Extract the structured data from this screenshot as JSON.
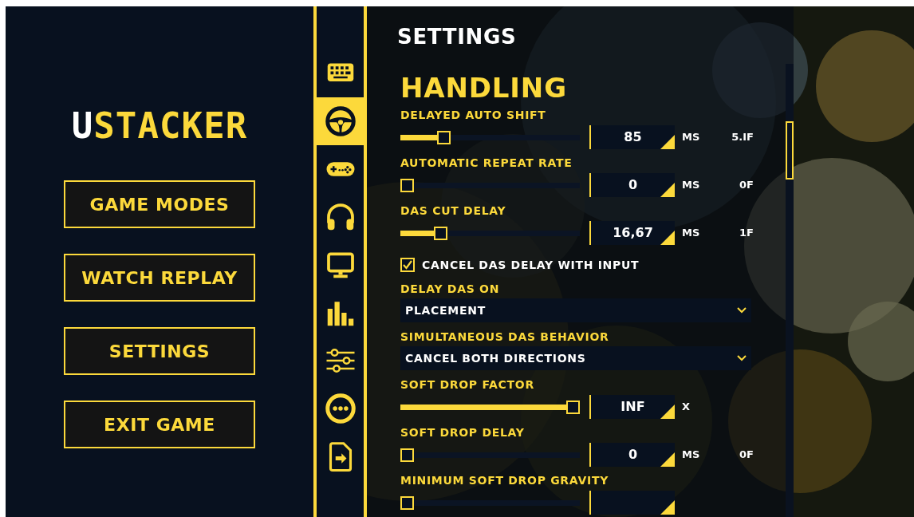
{
  "logo": {
    "lead": "U",
    "rest": "STACKER"
  },
  "menu": [
    "GAME MODES",
    "WATCH REPLAY",
    "SETTINGS",
    "EXIT GAME"
  ],
  "tabs": [
    {
      "selected": false
    },
    {
      "selected": true
    },
    {
      "selected": false
    },
    {
      "selected": false
    },
    {
      "selected": false
    },
    {
      "selected": false
    },
    {
      "selected": false
    },
    {
      "selected": false
    },
    {
      "selected": false
    }
  ],
  "title": "SETTINGS",
  "section": "HANDLING",
  "settings": [
    {
      "kind": "slider",
      "label": "DELAYED AUTO SHIFT",
      "level": 0.22,
      "value": "85",
      "unit": "MS",
      "frames": "5.IF"
    },
    {
      "kind": "slider",
      "label": "AUTOMATIC REPEAT RATE",
      "level": 0,
      "value": "0",
      "unit": "MS",
      "frames": "0F"
    },
    {
      "kind": "slider",
      "label": "DAS CUT DELAY",
      "level": 0.2,
      "value": "16,67",
      "unit": "MS",
      "frames": "1F"
    },
    {
      "kind": "checkbox",
      "label": "CANCEL DAS DELAY WITH INPUT",
      "checked": true
    },
    {
      "kind": "select",
      "label": "DELAY DAS ON",
      "value": "PLACEMENT"
    },
    {
      "kind": "select",
      "label": "SIMULTANEOUS DAS BEHAVIOR",
      "value": "CANCEL BOTH DIRECTIONS"
    },
    {
      "kind": "slider",
      "label": "SOFT DROP FACTOR",
      "level": 1,
      "value": "INF",
      "unit": "X"
    },
    {
      "kind": "slider",
      "label": "SOFT DROP DELAY",
      "level": 0,
      "value": "0",
      "unit": "MS",
      "frames": "0F"
    },
    {
      "kind": "slider",
      "label": "MINIMUM SOFT DROP GRAVITY",
      "level": 0
    }
  ]
}
